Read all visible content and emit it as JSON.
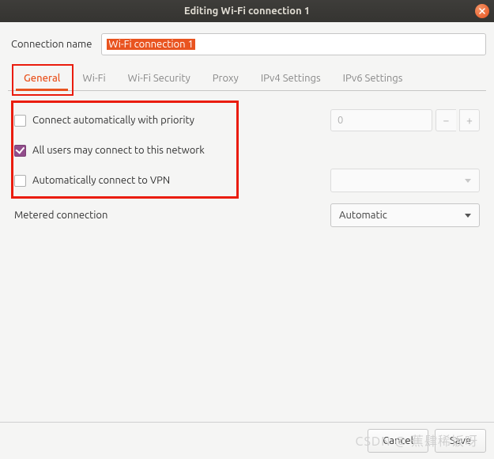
{
  "titlebar": {
    "title": "Editing Wi-Fi connection 1"
  },
  "close": {
    "icon": "close-icon"
  },
  "connection": {
    "label": "Connection name",
    "value": "Wi-Fi connection 1"
  },
  "tabs": {
    "general": "General",
    "wifi": "Wi-Fi",
    "security": "Wi-Fi Security",
    "proxy": "Proxy",
    "ipv4": "IPv4 Settings",
    "ipv6": "IPv6 Settings",
    "active": "general"
  },
  "general": {
    "autoconnect": {
      "label": "Connect automatically with priority",
      "checked": false,
      "priority": "0"
    },
    "allusers": {
      "label": "All users may connect to this network",
      "checked": true
    },
    "autovpn": {
      "label": "Automatically connect to VPN",
      "checked": false,
      "vpn_selected": ""
    },
    "metered": {
      "label": "Metered connection",
      "selected": "Automatic"
    }
  },
  "footer": {
    "cancel": "Cancel",
    "save": "Save"
  },
  "watermark": "CSDN @ 蕉肆稀饭呀"
}
